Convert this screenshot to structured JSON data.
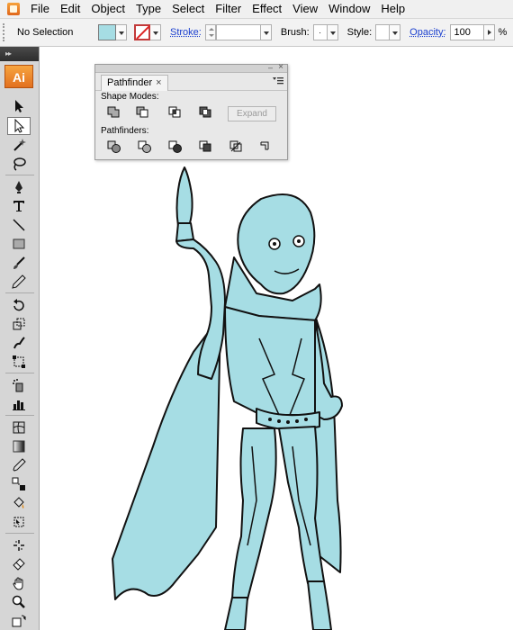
{
  "menubar": {
    "items": [
      {
        "label": "File",
        "name": "menu-file"
      },
      {
        "label": "Edit",
        "name": "menu-edit"
      },
      {
        "label": "Object",
        "name": "menu-object"
      },
      {
        "label": "Type",
        "name": "menu-type"
      },
      {
        "label": "Select",
        "name": "menu-select"
      },
      {
        "label": "Filter",
        "name": "menu-filter"
      },
      {
        "label": "Effect",
        "name": "menu-effect"
      },
      {
        "label": "View",
        "name": "menu-view"
      },
      {
        "label": "Window",
        "name": "menu-window"
      },
      {
        "label": "Help",
        "name": "menu-help"
      }
    ]
  },
  "controlbar": {
    "selection_label": "No Selection",
    "fill_color": "#a6dde4",
    "stroke_label": "Stroke:",
    "brush_label": "Brush:",
    "brush_value": "·",
    "style_label": "Style:",
    "opacity_label": "Opacity:",
    "opacity_value": "100",
    "percent": "%"
  },
  "toolbox": {
    "logo": "Ai",
    "header": "▸▸"
  },
  "pathfinder": {
    "tab_label": "Pathfinder",
    "tab_close": "×",
    "minimize": "‒",
    "close": "×",
    "shape_modes_label": "Shape Modes:",
    "pathfinders_label": "Pathfinders:",
    "expand_label": "Expand"
  },
  "artwork": {
    "fill_color": "#a6dde4",
    "line_color": "#111111"
  }
}
